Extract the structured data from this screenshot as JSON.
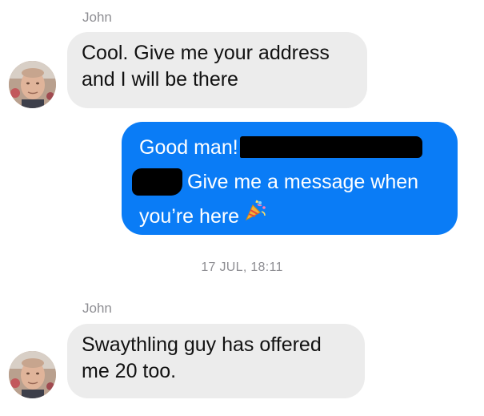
{
  "messages": [
    {
      "sender": "John",
      "direction": "incoming",
      "lines": [
        "Cool. Give me your address",
        "and I will be there"
      ]
    },
    {
      "direction": "outgoing",
      "line1": "Good man!",
      "line2": "Give me a message when",
      "line3": "you’re here",
      "emoji_icon": "party-popper-icon",
      "redacted": true
    },
    {
      "timestamp": "17 JUL, 18:11"
    },
    {
      "sender": "John",
      "direction": "incoming",
      "lines": [
        "Swaythling guy has offered",
        "me 20 too."
      ]
    }
  ],
  "colors": {
    "incoming_bubble": "#ececec",
    "outgoing_bubble": "#0a7cf6",
    "meta_text": "#8e8e93"
  }
}
